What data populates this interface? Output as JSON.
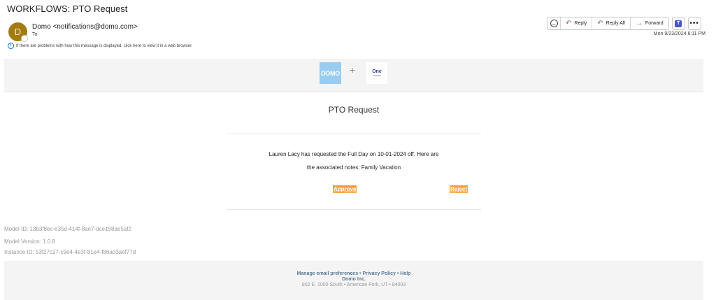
{
  "subject": "WORKFLOWS: PTO Request",
  "sender": {
    "initial": "D",
    "display": "Domo <notifications@domo.com>",
    "to_label": "To"
  },
  "infobar": "If there are problems with how this message is displayed, click here to view it in a web browser.",
  "actions": {
    "reply": "Reply",
    "reply_all": "Reply All",
    "forward": "Forward",
    "more": "•••"
  },
  "date": "Mon 9/23/2024 6:11 PM",
  "logos": {
    "domo": "DOMO",
    "plus": "+",
    "oa_one": "One",
    "oa_sub": "Analytics"
  },
  "email": {
    "title": "PTO Request",
    "line1": "Lauren Lacy has requested the Full Day on 10-01-2024 off. Here are",
    "line2": "the associated notes: Family Vacation",
    "approve": "Approve",
    "reject": "Reject"
  },
  "meta": {
    "model_id": "Model ID: 13b3f8ec-e35d-414f-8ae7-dce198ae5af2",
    "model_version": "Model Version: 1.0.8",
    "instance_id": "Instance ID: 53f27c27-c9e4-4e3f-81e4-f86ad3aef77d"
  },
  "footer": {
    "manage": "Manage email preferences",
    "privacy": "Privacy Policy",
    "help": "Help",
    "sep": " • ",
    "company": "Domo Inc.",
    "address": "802 E. 1050 South • American Fork, UT • 84003"
  },
  "colors": {
    "accent_button": "#f5a03a",
    "avatar": "#a27b13",
    "domo_logo": "#99ccee",
    "teams": "#4b53bc"
  }
}
